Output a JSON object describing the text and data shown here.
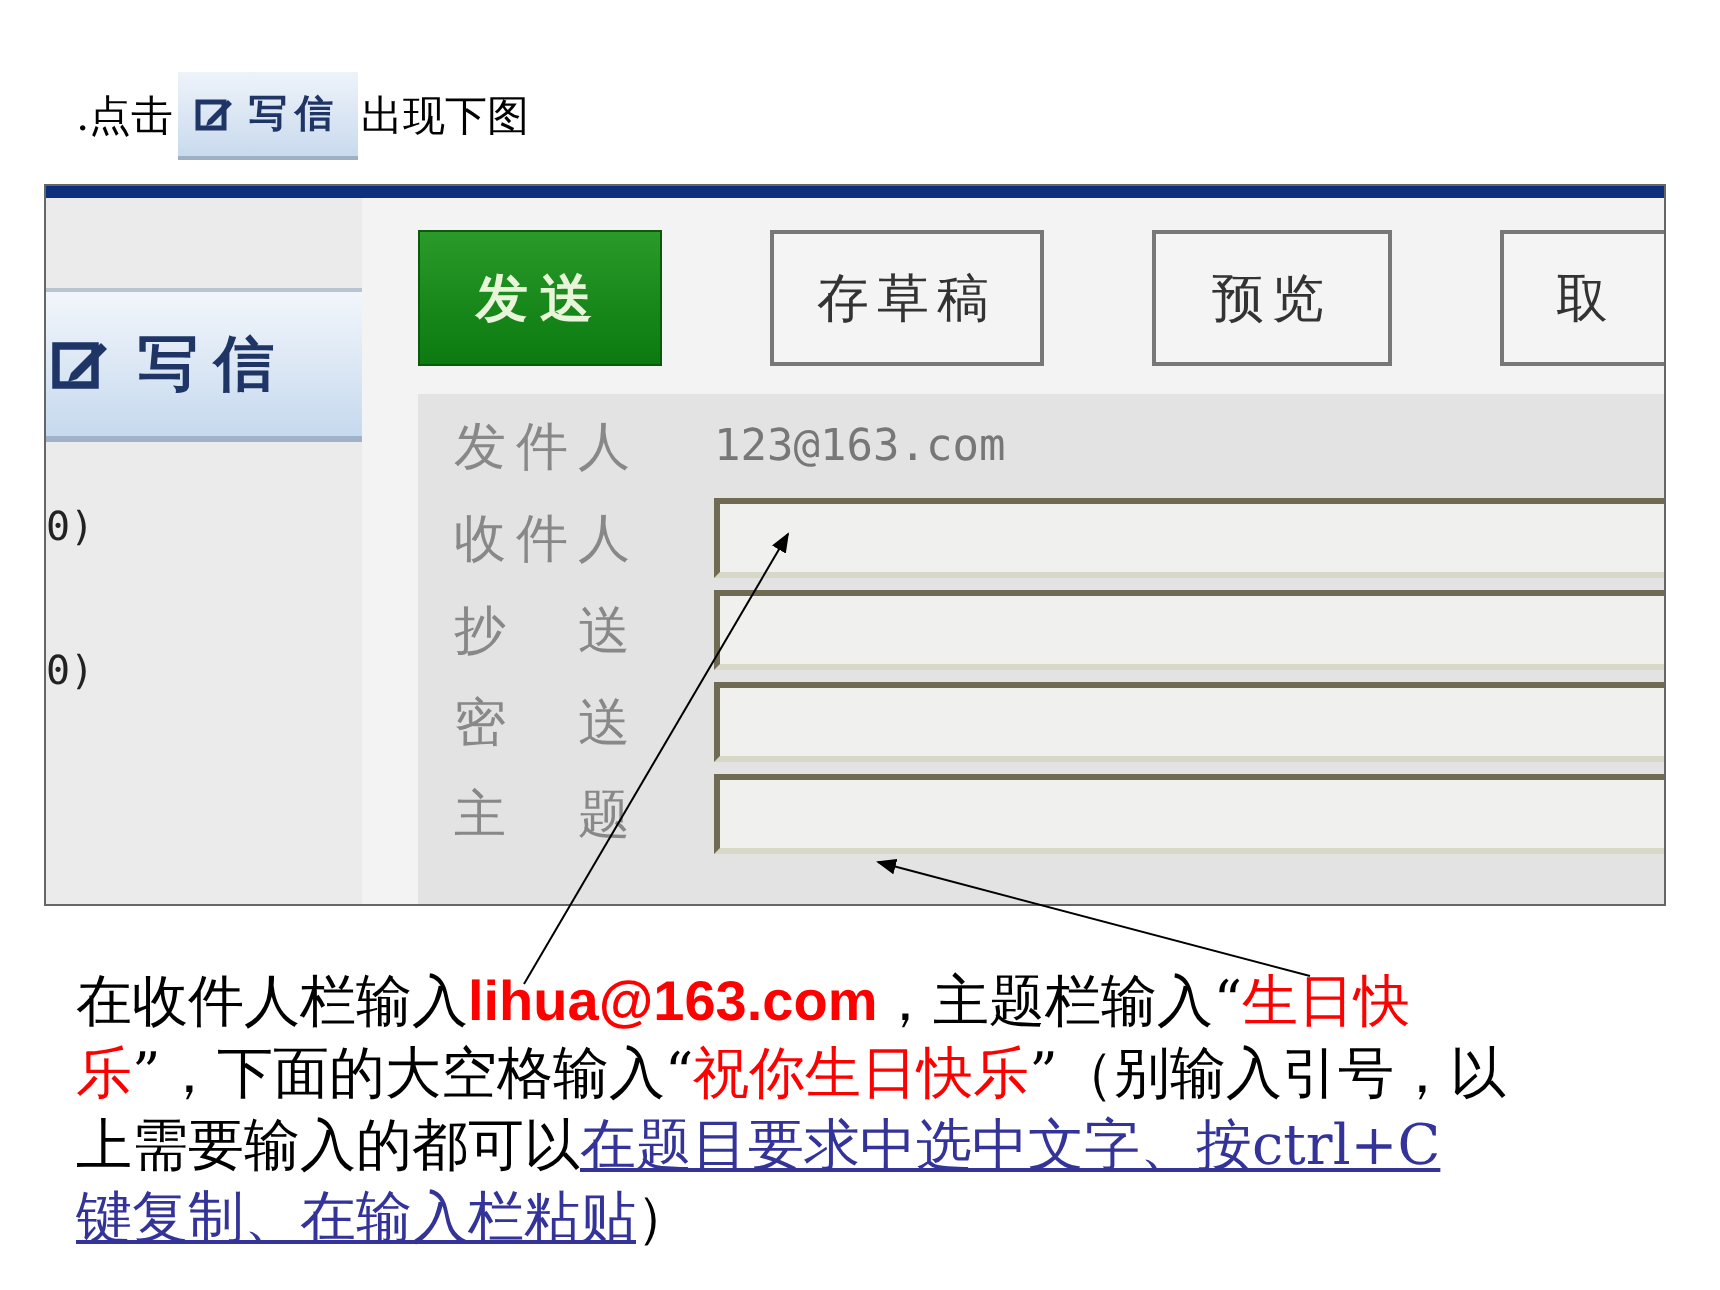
{
  "intro": {
    "before": ".点击",
    "button": {
      "label": "写信"
    },
    "after": "出现下图"
  },
  "screenshot": {
    "sidebar": {
      "compose": {
        "label": "写信"
      },
      "counts": [
        "0)",
        "0)"
      ]
    },
    "toolbar": [
      {
        "label": "发送",
        "kind": "primary"
      },
      {
        "label": "存草稿",
        "kind": "normal"
      },
      {
        "label": "预览",
        "kind": "normal"
      },
      {
        "label": "取",
        "kind": "cut"
      }
    ],
    "sender": {
      "label": "发件人",
      "value": "123@163.com"
    },
    "fields": [
      {
        "label": "收件人"
      },
      {
        "label": "抄 送"
      },
      {
        "label": "密 送"
      },
      {
        "label": "主 题"
      }
    ]
  },
  "instruction": {
    "runs": [
      {
        "kind": "plain",
        "text": "在收件人栏输入"
      },
      {
        "kind": "highlight",
        "text": "lihua@163.com",
        "bold": true
      },
      {
        "kind": "plain",
        "text": "，主题栏输入“"
      },
      {
        "kind": "highlight",
        "text": "生日快乐",
        "bold": false
      },
      {
        "kind": "plain",
        "text": "”，下面的大空格输入“"
      },
      {
        "kind": "highlight",
        "text": "祝你生日快乐",
        "bold": false
      },
      {
        "kind": "plain",
        "text": "”（别输入引号，以上需要输入的都可以"
      },
      {
        "kind": "link",
        "text": "在题目要求中选中文字、按ctrl+C"
      },
      {
        "kind": "link",
        "text": "键复制、在输入栏粘贴"
      },
      {
        "kind": "plain",
        "text": "）"
      }
    ]
  }
}
